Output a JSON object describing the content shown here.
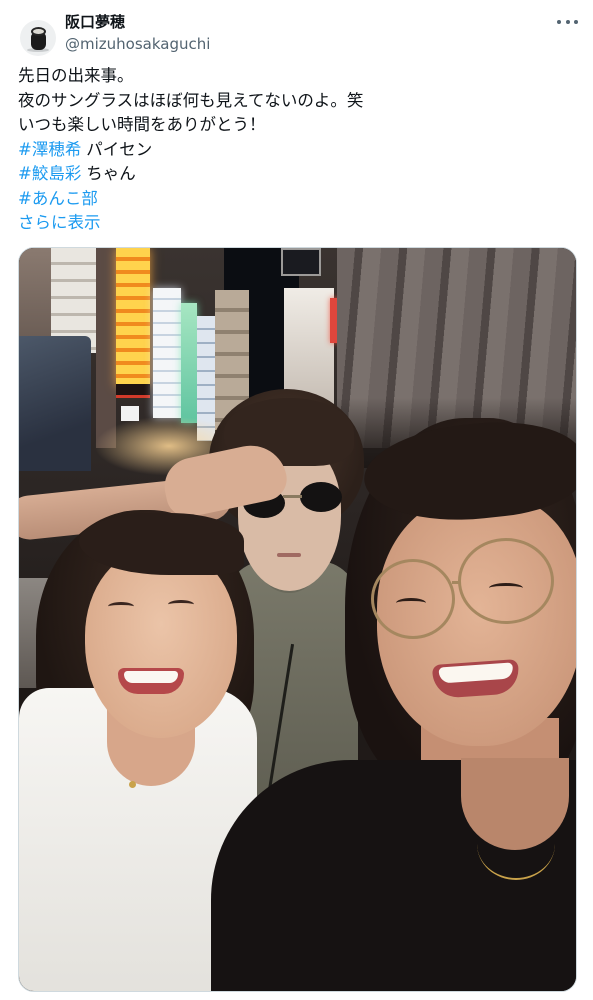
{
  "post": {
    "author": {
      "display_name": "阪口夢穂",
      "handle": "@mizuhosakaguchi"
    },
    "text_lines": [
      "先日の出来事。",
      "夜のサングラスはほぼ何も見えてないのよ。笑",
      "いつも楽しい時間をありがとう！"
    ],
    "hashtag_lines": [
      {
        "tag": "#澤穂希",
        "suffix": "パイセン"
      },
      {
        "tag": "#鮫島彩",
        "suffix": "ちゃん"
      },
      {
        "tag": "#あんこ部"
      }
    ],
    "show_more_label": "さらに表示"
  },
  "icons": {
    "avatar": "author-avatar",
    "more": "more-horizontal-icon"
  },
  "colors": {
    "text": "#0f1419",
    "secondary_text": "#536471",
    "link": "#1d9bf0",
    "background": "#ffffff"
  }
}
